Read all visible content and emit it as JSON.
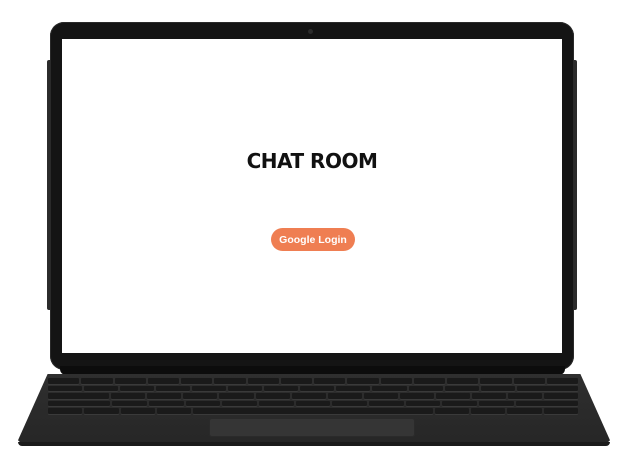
{
  "screen": {
    "title": "CHAT ROOM",
    "login_button_label": "Google Login"
  },
  "colors": {
    "login_button": "#ef7e52",
    "title_text": "#111111",
    "screen_background": "#ffffff",
    "device_body": "#141414"
  },
  "icons": {
    "camera": "webcam-icon"
  }
}
